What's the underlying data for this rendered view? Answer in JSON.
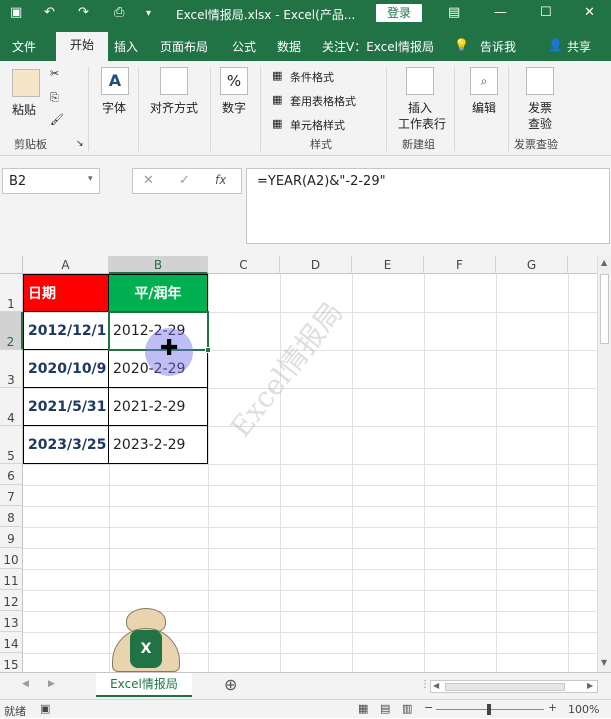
{
  "titlebar": {
    "save_icon": "save-icon",
    "undo_icon": "undo-icon",
    "redo_icon": "redo-icon",
    "preview_icon": "print-preview-icon",
    "title": "Excel情报局.xlsx - Excel(产品...",
    "login_label": "登录",
    "restore_icon": "ribbon-display-icon",
    "minimize": "—",
    "maximize": "☐",
    "close": "✕"
  },
  "menu": {
    "file": "文件",
    "home": "开始",
    "insert": "插入",
    "layout": "页面布局",
    "formulas": "公式",
    "data": "数据",
    "follow": "关注V：Excel情报局",
    "tell_me": "告诉我",
    "share": "共享"
  },
  "ribbon": {
    "paste": "粘贴",
    "clipboard": "剪贴板",
    "font": "字体",
    "font_letter": "A",
    "align": "对齐方式",
    "number": "数字",
    "number_symbol": "%",
    "cond_format": "条件格式",
    "table_format": "套用表格格式",
    "cell_style": "单元格样式",
    "styles": "样式",
    "insert_row": "插入",
    "insert_row2": "工作表行",
    "new_group": "新建组",
    "edit": "编辑",
    "invoice": "发票",
    "invoice2": "查验",
    "invoice_group": "发票查验"
  },
  "formula_bar": {
    "name_box": "B2",
    "cancel": "✕",
    "enter": "✓",
    "fx": "fx",
    "formula": "=YEAR(A2)&\"-2-29\""
  },
  "grid": {
    "columns": [
      "A",
      "B",
      "C",
      "D",
      "E",
      "F",
      "G"
    ],
    "rows": [
      "1",
      "2",
      "3",
      "4",
      "5",
      "6",
      "7",
      "8",
      "9",
      "10",
      "11",
      "12",
      "13",
      "14",
      "15"
    ],
    "header_a": "日期",
    "header_b": "平/润年",
    "dates": [
      "2012/12/1",
      "2020/10/9",
      "2021/5/31",
      "2023/3/25"
    ],
    "results": [
      "2012-2-29",
      "2020-2-29",
      "2021-2-29",
      "2023-2-29"
    ],
    "header_a_color": "#ff0000",
    "header_b_color": "#00b050"
  },
  "watermark": "Excel情报局",
  "sheet_tab": "Excel情报局",
  "add_sheet": "⊕",
  "status": {
    "ready": "就绪",
    "zoom": "100%"
  },
  "accent_color": "#217346"
}
